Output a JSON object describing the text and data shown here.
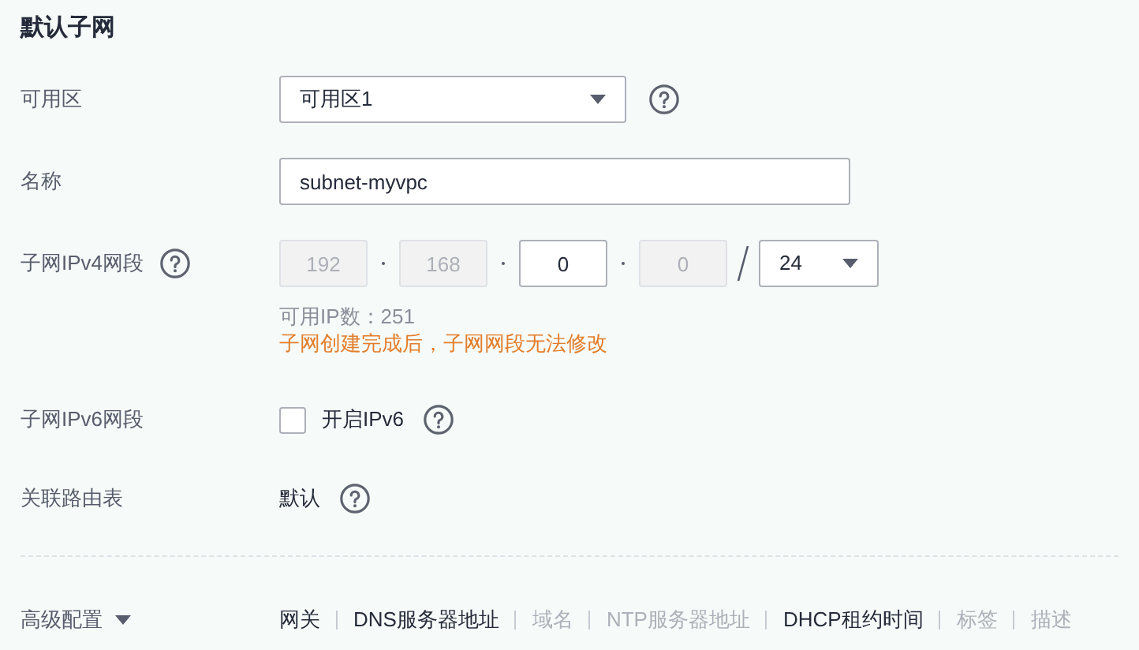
{
  "section_title": "默认子网",
  "availability_zone": {
    "label": "可用区",
    "value": "可用区1"
  },
  "name": {
    "label": "名称",
    "value": "subnet-myvpc"
  },
  "ipv4": {
    "label": "子网IPv4网段",
    "octets": [
      {
        "value": "192",
        "disabled": true
      },
      {
        "value": "168",
        "disabled": true
      },
      {
        "value": "0",
        "disabled": false
      },
      {
        "value": "0",
        "disabled": true
      }
    ],
    "prefix": "24",
    "available_ips": "可用IP数：251",
    "warning": "子网创建完成后，子网网段无法修改"
  },
  "ipv6": {
    "label": "子网IPv6网段",
    "option": "开启IPv6",
    "checked": false
  },
  "route_table": {
    "label": "关联路由表",
    "value": "默认"
  },
  "advanced": {
    "label": "高级配置",
    "items": [
      {
        "label": "网关",
        "enabled": true
      },
      {
        "label": "DNS服务器地址",
        "enabled": true
      },
      {
        "label": "域名",
        "enabled": false
      },
      {
        "label": "NTP服务器地址",
        "enabled": false
      },
      {
        "label": "DHCP租约时间",
        "enabled": true
      },
      {
        "label": "标签",
        "enabled": false
      },
      {
        "label": "描述",
        "enabled": false
      }
    ]
  }
}
